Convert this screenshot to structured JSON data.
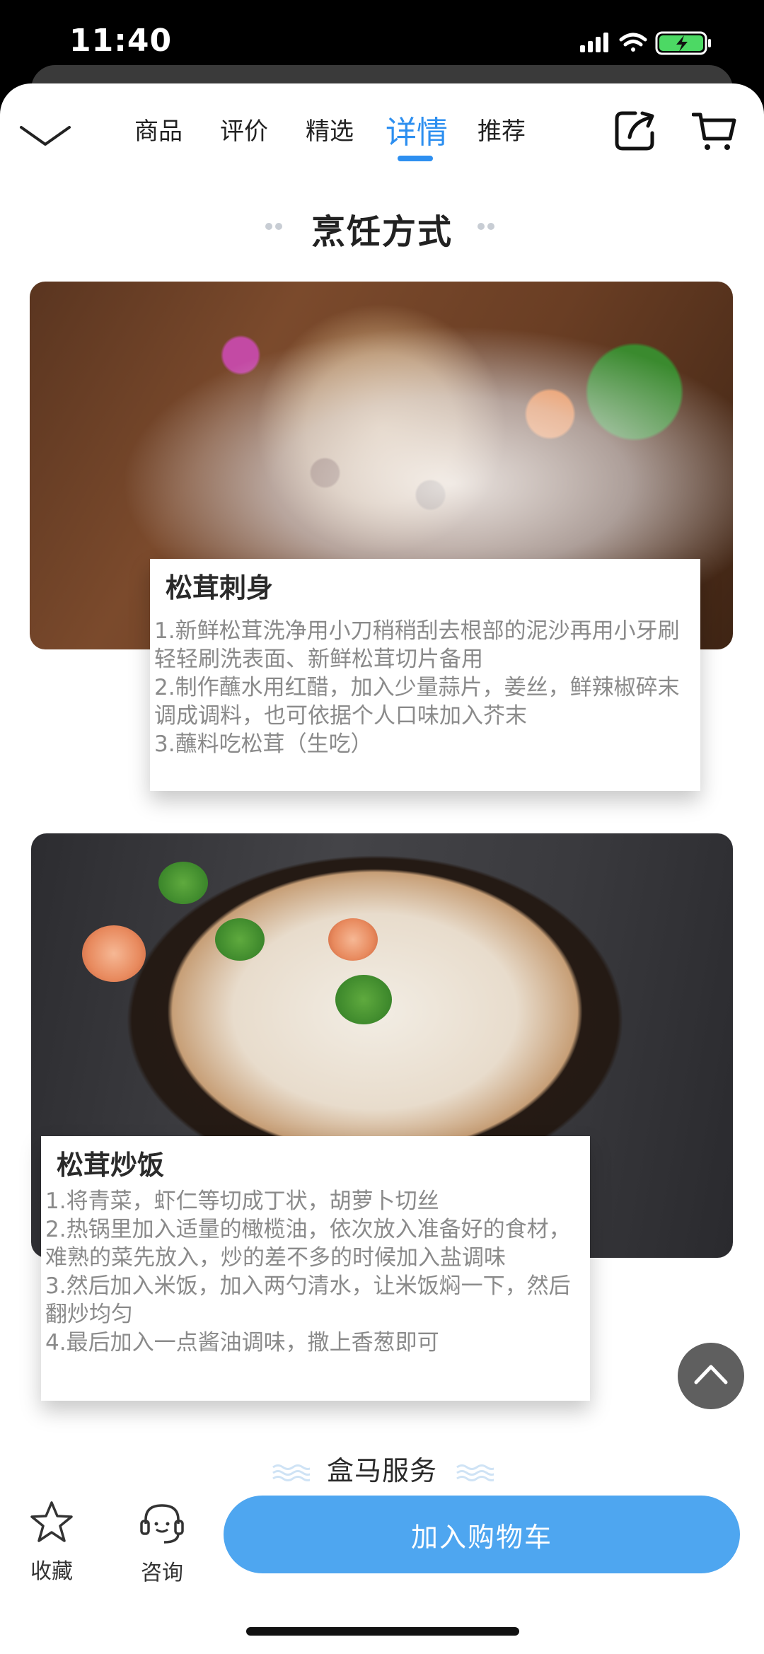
{
  "status": {
    "time": "11:40"
  },
  "nav": {
    "tabs": [
      {
        "label": "商品",
        "active": false
      },
      {
        "label": "评价",
        "active": false
      },
      {
        "label": "精选",
        "active": false
      },
      {
        "label": "详情",
        "active": true
      },
      {
        "label": "推荐",
        "active": false
      }
    ],
    "active_color": "#2d8ff0"
  },
  "section": {
    "title": "烹饪方式"
  },
  "recipes": [
    {
      "title": "松茸刺身",
      "lines": [
        "1.新鲜松茸洗净用小刀稍稍刮去根部的泥沙再用小牙刷轻轻刷洗表面、新鲜松茸切片备用",
        "2.制作蘸水用红醋，加入少量蒜片，姜丝，鲜辣椒碎末调成调料，也可依据个人口味加入芥末",
        "3.蘸料吃松茸（生吃）"
      ]
    },
    {
      "title": "松茸炒饭",
      "lines": [
        "1.将青菜，虾仁等切成丁状，胡萝卜切丝",
        "2.热锅里加入适量的橄榄油，依次放入准备好的食材，难熟的菜先放入，炒的差不多的时候加入盐调味",
        "3.然后加入米饭，加入两勺清水，让米饭焖一下，然后翻炒均匀",
        "4.最后加入一点酱油调味，撒上香葱即可"
      ]
    }
  ],
  "service": {
    "title": "盒马服务"
  },
  "bottom": {
    "favorite_label": "收藏",
    "consult_label": "咨询",
    "add_to_cart_label": "加入购物车",
    "button_color": "#4ea6f0"
  },
  "icons": [
    "chevron-down-icon",
    "share-icon",
    "cart-icon",
    "star-icon",
    "headset-icon",
    "arrow-up-icon"
  ]
}
